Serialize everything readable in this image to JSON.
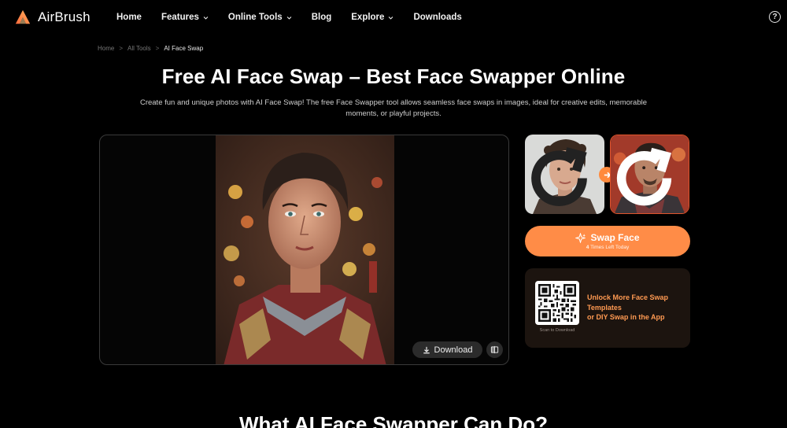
{
  "brand": {
    "name": "AirBrush",
    "logo_icon": "airbrush-logo-icon",
    "accent": "#ff8c47"
  },
  "nav": {
    "items": [
      {
        "label": "Home",
        "has_dropdown": false
      },
      {
        "label": "Features",
        "has_dropdown": true
      },
      {
        "label": "Online Tools",
        "has_dropdown": true
      },
      {
        "label": "Blog",
        "has_dropdown": false
      },
      {
        "label": "Explore",
        "has_dropdown": true
      },
      {
        "label": "Downloads",
        "has_dropdown": false
      }
    ],
    "help_icon": "help-circle-icon",
    "help_glyph": "?"
  },
  "breadcrumb": {
    "items": [
      "Home",
      "All Tools",
      "AI Face Swap"
    ],
    "separator": ">"
  },
  "hero": {
    "title": "Free AI Face Swap – Best Face Swapper Online",
    "subtitle": "Create fun and unique photos with AI Face Swap! The free Face Swapper tool allows seamless face swaps in images, ideal for creative edits, memorable moments, or playful projects."
  },
  "viewer": {
    "download_label": "Download",
    "download_icon": "download-icon",
    "compare_icon": "compare-icon"
  },
  "faces": {
    "source_refresh_icon": "refresh-icon",
    "target_refresh_icon": "refresh-icon",
    "arrow_icon": "arrow-right-icon"
  },
  "swap": {
    "label": "Swap Face",
    "icon": "sparkle-icon",
    "remaining_count": "4",
    "remaining_text": "Times Left Today"
  },
  "promo": {
    "qr_label": "Scan to Download",
    "line1": "Unlock More Face Swap",
    "line2": "Templates",
    "line3": "or DIY Swap in the App",
    "bg_color": "#1c140f",
    "text_color": "#ff9a52"
  },
  "section": {
    "heading": "What AI Face Swapper Can Do?"
  }
}
